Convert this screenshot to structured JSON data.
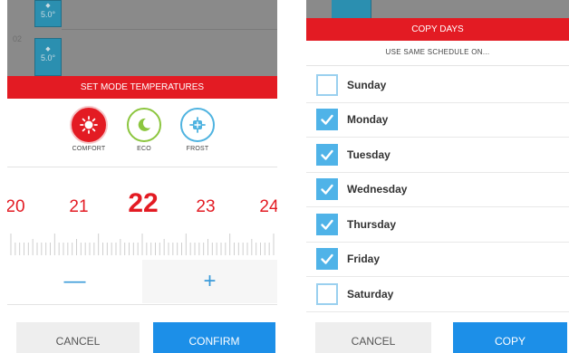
{
  "left": {
    "schedule": {
      "row_label": "02",
      "blocks": [
        {
          "value": "5.0°"
        },
        {
          "value": "5.0°"
        }
      ]
    },
    "header": "SET MODE TEMPERATURES",
    "modes": [
      {
        "label": "COMFORT",
        "icon": "sun-icon",
        "color": "#e31b23",
        "selected": true
      },
      {
        "label": "ECO",
        "icon": "moon-icon",
        "color": "#8cc63f",
        "selected": false
      },
      {
        "label": "FROST",
        "icon": "snowflake-icon",
        "color": "#4fb3e0",
        "selected": false
      }
    ],
    "temperatures": [
      "20",
      "21",
      "22",
      "23",
      "24"
    ],
    "selected_temperature": "22",
    "minus_label": "—",
    "plus_label": "+",
    "cancel_label": "CANCEL",
    "confirm_label": "CONFIRM"
  },
  "right": {
    "header": "COPY DAYS",
    "subtitle": "USE SAME SCHEDULE ON...",
    "days": [
      {
        "label": "Sunday",
        "checked": false
      },
      {
        "label": "Monday",
        "checked": true
      },
      {
        "label": "Tuesday",
        "checked": true
      },
      {
        "label": "Wednesday",
        "checked": true
      },
      {
        "label": "Thursday",
        "checked": true
      },
      {
        "label": "Friday",
        "checked": true
      },
      {
        "label": "Saturday",
        "checked": false
      }
    ],
    "cancel_label": "CANCEL",
    "copy_label": "COPY"
  },
  "colors": {
    "accent_red": "#e31b23",
    "accent_blue": "#1c8fe8",
    "checkbox_blue": "#4fb3e8"
  }
}
